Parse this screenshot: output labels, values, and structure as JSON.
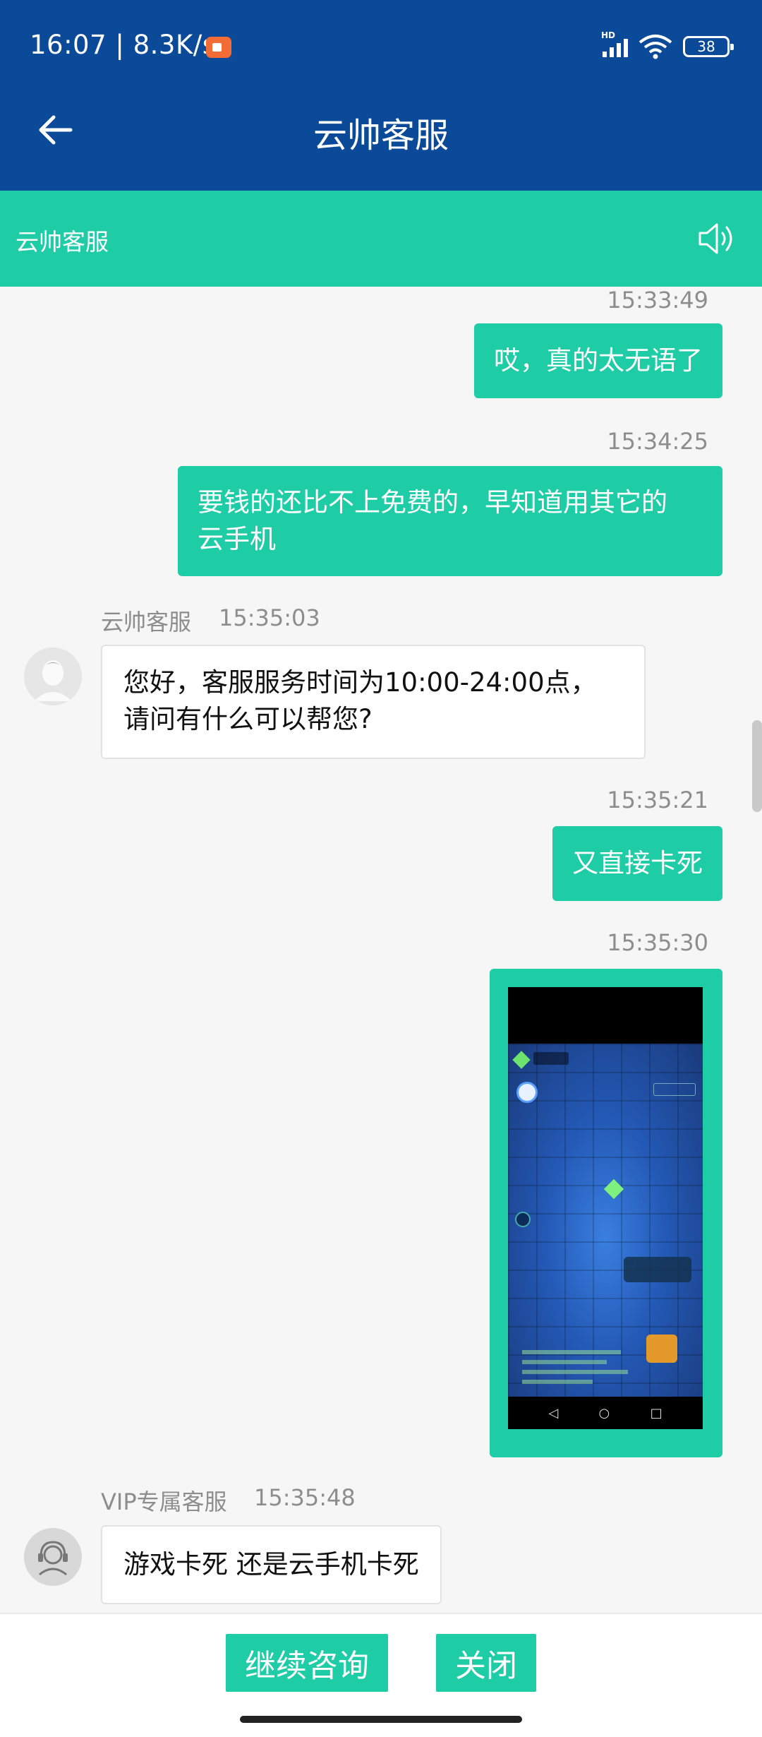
{
  "status_bar": {
    "time": "16:07 | 8.3K/s",
    "network_badge": "HD",
    "battery": "38",
    "icons": [
      "record-icon",
      "signal-icon",
      "wifi-icon",
      "battery-icon"
    ]
  },
  "app_bar": {
    "title": "云帅客服",
    "back_icon": "arrow-left-icon"
  },
  "sub_header": {
    "title": "云帅客服",
    "speaker_icon": "speaker-icon"
  },
  "messages": [
    {
      "direction": "out",
      "time": "15:33:49",
      "text": "哎，真的太无语了"
    },
    {
      "direction": "out",
      "time": "15:34:25",
      "lines": [
        "要钱的还比不上免费的，早知道用其它的",
        "云手机"
      ]
    },
    {
      "direction": "in",
      "sender": "云帅客服",
      "time": "15:35:03",
      "lines": [
        "您好，客服服务时间为10:00-24:00点，",
        "请问有什么可以帮您?"
      ]
    },
    {
      "direction": "out",
      "time": "15:35:21",
      "text": "又直接卡死"
    },
    {
      "direction": "out",
      "time": "15:35:30",
      "type": "image"
    },
    {
      "direction": "in",
      "sender": "VIP专属客服",
      "time": "15:35:48",
      "text": "游戏卡死 还是云手机卡死"
    }
  ],
  "bottom_bar": {
    "continue_label": "继续咨询",
    "close_label": "关闭"
  },
  "colors": {
    "header_blue": "#0a4a98",
    "accent_green": "#1ecca6",
    "chat_bg": "#f6f6f6"
  }
}
